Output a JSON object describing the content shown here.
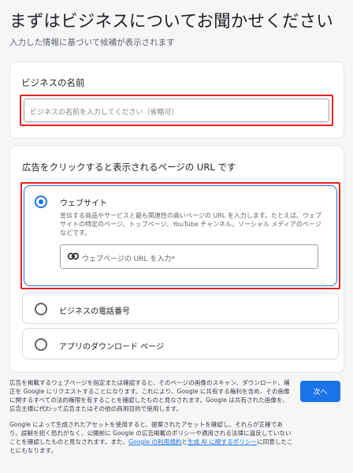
{
  "header": {
    "title": "まずはビジネスについてお聞かせください",
    "subtitle": "入力した情報に基づいて候補が表示されます"
  },
  "business_name": {
    "label": "ビジネスの名前",
    "placeholder": "ビジネスの名前を入力してください（省略可）"
  },
  "landing": {
    "heading": "広告をクリックすると表示されるページの URL です",
    "options": [
      {
        "label": "ウェブサイト",
        "selected": true,
        "description": "宣伝する商品やサービスと最も関連性の高いページの URL を入力します。たとえば、ウェブサイトの特定のページ、トップページ、YouTube チャンネル、ソーシャル メディアのページなどです。",
        "input_placeholder": "ウェブページの URL を入力*",
        "input_icon": "link-icon"
      },
      {
        "label": "ビジネスの電話番号",
        "selected": false
      },
      {
        "label": "アプリのダウンロード ページ",
        "selected": false
      }
    ]
  },
  "footer": {
    "para1": "広告を掲載するウェブページを指定または確認すると、そのページの画像のスキャン、ダウンロード、補正を Google にリクエストすることになります。これにより、Google に共有する権利を含め、その画像に関するすべての法的権限を有することを確認したものと見なされます。Google は共有された画像を、広告主様に代わって広告またはその他の商用目的で使用します。",
    "para2_pre": "Google によって生成されたアセットを使用すると、提案されたアセットを確認し、それらが正確であり、誤解を招く恐れがなく、公開前に Google の広告掲載のポリシーや適用される法律に違反していないことを確認したものと見なされます。また、",
    "link1": "Google の利用規約",
    "para2_mid": "と",
    "link2": "生成 AI に関するポリシー",
    "para2_post": "に同意したことにもなります。"
  },
  "next_button": {
    "label": "次へ"
  },
  "colors": {
    "accent": "#1a73e8",
    "highlight": "#e3231e"
  }
}
